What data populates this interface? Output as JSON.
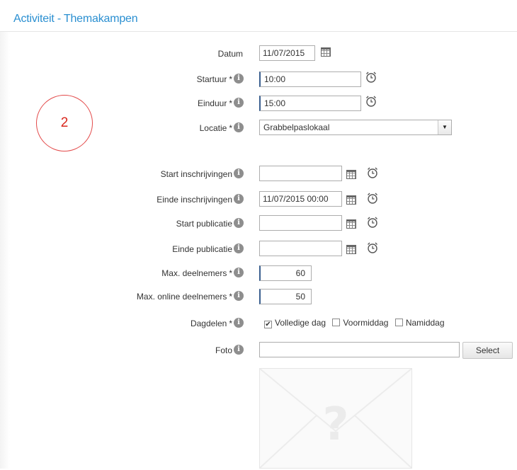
{
  "header": {
    "title": "Activiteit - Themakampen"
  },
  "annotation": {
    "step": "2"
  },
  "colors": {
    "accent": "#2a8fd1",
    "annotation": "#d9261c"
  },
  "form": {
    "datum": {
      "label": "Datum",
      "value": "11/07/2015"
    },
    "startuur": {
      "label": "Startuur",
      "required": "*",
      "value": "10:00"
    },
    "einduur": {
      "label": "Einduur",
      "required": "*",
      "value": "15:00"
    },
    "locatie": {
      "label": "Locatie",
      "required": "*",
      "value": "Grabbelpaslokaal"
    },
    "start_inschrijvingen": {
      "label": "Start inschrijvingen",
      "value": ""
    },
    "einde_inschrijvingen": {
      "label": "Einde inschrijvingen",
      "value": "11/07/2015 00:00"
    },
    "start_publicatie": {
      "label": "Start publicatie",
      "value": ""
    },
    "einde_publicatie": {
      "label": "Einde publicatie",
      "value": ""
    },
    "max_deelnemers": {
      "label": "Max. deelnemers",
      "required": "*",
      "value": "60"
    },
    "max_online_deelnemers": {
      "label": "Max. online deelnemers",
      "required": "*",
      "value": "50"
    },
    "dagdelen": {
      "label": "Dagdelen",
      "required": "*",
      "options": [
        {
          "label": "Volledige dag",
          "checked": true
        },
        {
          "label": "Voormiddag",
          "checked": false
        },
        {
          "label": "Namiddag",
          "checked": false
        }
      ]
    },
    "foto": {
      "label": "Foto",
      "value": "",
      "button_label": "Select"
    }
  },
  "icons": {
    "info": "info-icon",
    "calendar": "calendar-icon",
    "clock": "alarm-clock-icon",
    "dropdown": "chevron-down-icon",
    "image_placeholder": "image-placeholder-icon"
  }
}
